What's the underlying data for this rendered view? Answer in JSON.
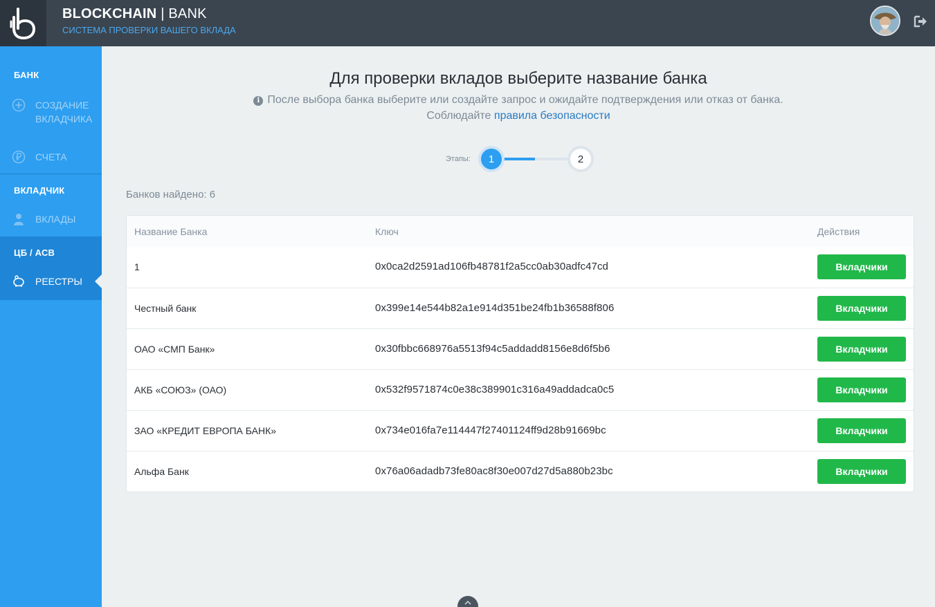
{
  "header": {
    "brand_bold": "BLOCKCHAIN",
    "brand_separator": "|",
    "brand_light": "BANK",
    "subtitle": "СИСТЕМА ПРОВЕРКИ ВАШЕГО ВКЛАДА"
  },
  "sidebar": {
    "sections": [
      {
        "title": "БАНК"
      },
      {
        "title": "ВКЛАДЧИК"
      },
      {
        "title": "ЦБ / АСВ"
      }
    ],
    "items": [
      {
        "label": "СОЗДАНИЕ ВКЛАДЧИКА",
        "icon": "plus-circle-icon"
      },
      {
        "label": "СЧЕТА",
        "icon": "ruble-icon"
      },
      {
        "label": "ВКЛАДЫ",
        "icon": "user-icon"
      },
      {
        "label": "РЕЕСТРЫ",
        "icon": "piggy-bank-icon",
        "active": true
      }
    ]
  },
  "main": {
    "title": "Для проверки вкладов выберите название банка",
    "note": "После выбора банка выберите или создайте запрос и ожидайте подтверждения или отказ от банка.",
    "rules_prefix": "Соблюдайте",
    "rules_link": "правила безопасности",
    "steps_label": "Этапы:",
    "steps": [
      "1",
      "2"
    ],
    "current_step": 1,
    "found_text": "Банков найдено: 6"
  },
  "table": {
    "headers": {
      "name": "Название Банка",
      "key": "Ключ",
      "actions": "Действия"
    },
    "rows": [
      {
        "name": "1",
        "key": "0x0ca2d2591ad106fb48781f2a5cc0ab30adfc47cd",
        "action": "Вкладчики"
      },
      {
        "name": "Честный банк",
        "key": "0x399e14e544b82a1e914d351be24fb1b36588f806",
        "action": "Вкладчики"
      },
      {
        "name": "ОАО «СМП Банк»",
        "key": "0x30fbbc668976a5513f94c5addadd8156e8d6f5b6",
        "action": "Вкладчики"
      },
      {
        "name": "АКБ «СОЮЗ» (ОАО)",
        "key": "0x532f9571874c0e38c389901c316a49addadca0c5",
        "action": "Вкладчики"
      },
      {
        "name": "ЗАО «КРЕДИТ ЕВРОПА БАНК»",
        "key": "0x734e016fa7e114447f27401124ff9d28b91669bc",
        "action": "Вкладчики"
      },
      {
        "name": "Альфа Банк",
        "key": "0x76a06adadb73fe80ac8f30e007d27d5a880b23bc",
        "action": "Вкладчики"
      }
    ]
  },
  "colors": {
    "header_bg": "#3b4550",
    "sidebar_bg": "#2d9ef0",
    "accent": "#2d9ef0",
    "button_green": "#21b84a"
  }
}
